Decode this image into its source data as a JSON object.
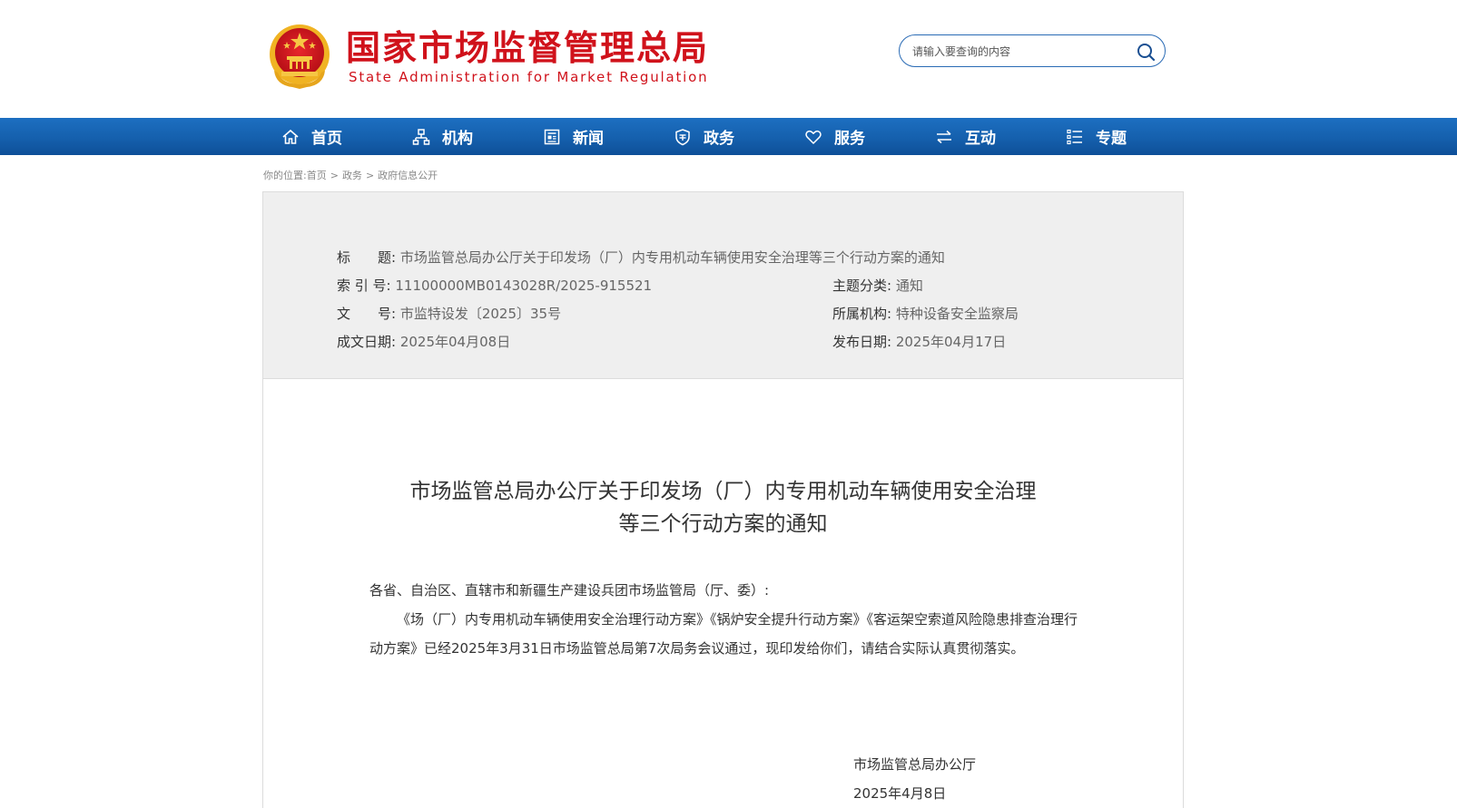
{
  "header": {
    "title": "国家市场监督管理总局",
    "subtitle": "State Administration for Market Regulation",
    "emblem_icon": "national-emblem-icon"
  },
  "search": {
    "placeholder": "请输入要查询的内容",
    "value": "",
    "icon": "search-icon"
  },
  "nav": {
    "items": [
      {
        "label": "首页",
        "icon": "home-icon"
      },
      {
        "label": "机构",
        "icon": "org-chart-icon"
      },
      {
        "label": "新闻",
        "icon": "news-icon"
      },
      {
        "label": "政务",
        "icon": "shield-icon"
      },
      {
        "label": "服务",
        "icon": "heart-icon"
      },
      {
        "label": "互动",
        "icon": "exchange-icon"
      },
      {
        "label": "专题",
        "icon": "list-icon"
      }
    ]
  },
  "breadcrumb": {
    "prefix": "你的位置:",
    "items": [
      "首页",
      "政务",
      "政府信息公开"
    ],
    "separator": ">"
  },
  "meta": {
    "title_label": "标　　题:",
    "title_value": "市场监管总局办公厅关于印发场（厂）内专用机动车辆使用安全治理等三个行动方案的通知",
    "index_label": "索 引 号:",
    "index_value": "11100000MB0143028R/2025-915521",
    "docno_label": "文　　号:",
    "docno_value": "市监特设发〔2025〕35号",
    "written_label": "成文日期:",
    "written_value": "2025年04月08日",
    "topic_label": "主题分类:",
    "topic_value": "通知",
    "org_label": "所属机构:",
    "org_value": "特种设备安全监察局",
    "publish_label": "发布日期:",
    "publish_value": "2025年04月17日"
  },
  "document": {
    "title_line1": "市场监管总局办公厅关于印发场（厂）内专用机动车辆使用安全治理",
    "title_line2": "等三个行动方案的通知",
    "salutation": "各省、自治区、直辖市和新疆生产建设兵团市场监管局（厅、委）:",
    "paragraph": "《场（厂）内专用机动车辆使用安全治理行动方案》《锅炉安全提升行动方案》《客运架空索道风险隐患排查治理行动方案》已经2025年3月31日市场监管总局第7次局务会议通过，现印发给你们，请结合实际认真贯彻落实。",
    "signature_org": "市场监管总局办公厅",
    "signature_date": "2025年4月8日"
  },
  "colors": {
    "brand_red": "#d0121b",
    "nav_blue": "#1560ad",
    "meta_bg": "#efefef"
  }
}
